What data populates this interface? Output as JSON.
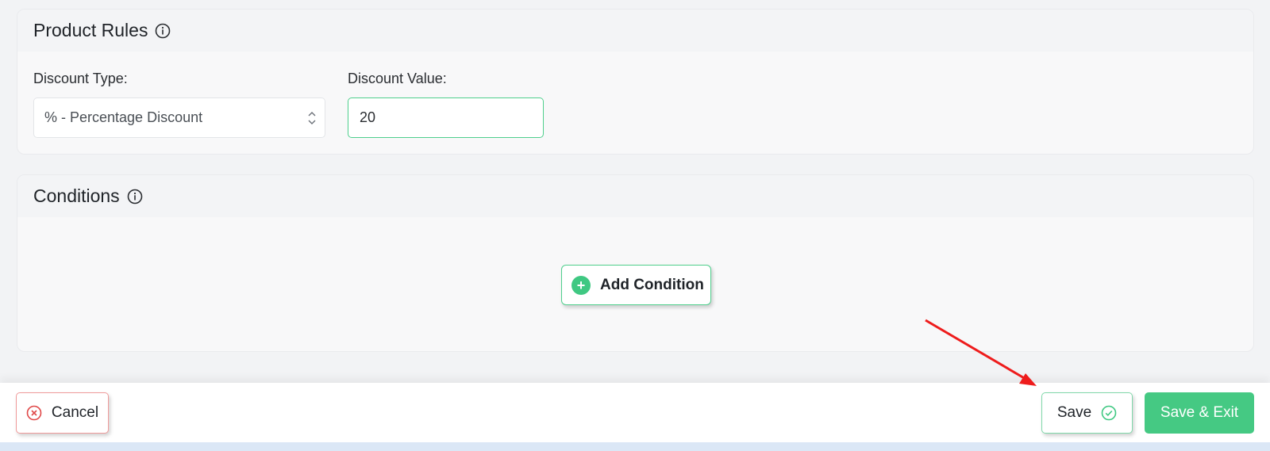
{
  "rules_panel": {
    "title": "Product Rules",
    "discount_type": {
      "label": "Discount Type:",
      "value": "% - Percentage Discount"
    },
    "discount_value": {
      "label": "Discount Value:",
      "value": "20"
    }
  },
  "conditions_panel": {
    "title": "Conditions",
    "add_button_label": "Add Condition"
  },
  "footer": {
    "cancel_label": "Cancel",
    "save_label": "Save",
    "save_exit_label": "Save & Exit"
  },
  "colors": {
    "accent_green": "#45c983",
    "cancel_red": "#e04848",
    "annotation_arrow": "#ee1c1c"
  },
  "icons": {
    "info": "info-circle-icon",
    "select": "chevron-up-down-icon",
    "add": "plus-circle-icon",
    "cancel": "x-circle-icon",
    "save": "check-circle-icon"
  }
}
